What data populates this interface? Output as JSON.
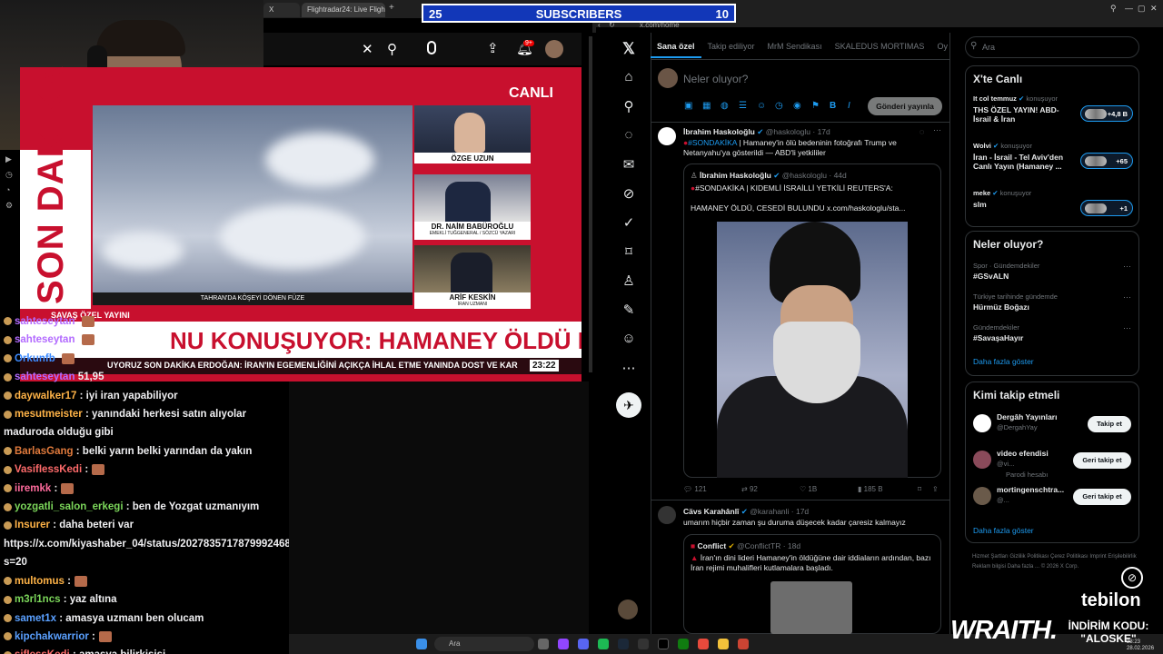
{
  "browser": {
    "tab1_label": "X",
    "tab2_label": "Flightradar24: Live Flight T",
    "new_tab": "+",
    "url": "x.com/home",
    "window_controls": [
      "⚲",
      "—",
      "▢",
      "✕"
    ]
  },
  "subscribers": {
    "left": "25",
    "label": "SUBSCRIBERS",
    "right": "10"
  },
  "youtube": {
    "notif_count": "9+"
  },
  "tv": {
    "son_dakika": "SON DAKİKA",
    "canli": "CANLI",
    "video_caption": "TAHRAN'DA KÖŞEYİ DÖNEN FÜZE",
    "panel1_name": "ÖZGE UZUN",
    "panel2_name": "DR. NAİM BABÜROĞLU",
    "panel2_sub": "EMEKLİ TUĞGENERAL / SÖZCÜ YAZARI",
    "panel3_name": "ARİF KESKİN",
    "panel3_sub": "İRAN UZMANI",
    "special": "SAVAŞ ÖZEL YAYINI",
    "headline": "NU KONUŞUYOR: HAMANEY ÖLDÜ MÜ?",
    "ticker": "UYORUZ  SON DAKİKA  ERDOĞAN: İRAN'IN EGEMENLİĞİNİ AÇIKÇA İHLAL ETME YANINDA DOST VE KAR",
    "clock": "23:22"
  },
  "chat": {
    "messages": [
      {
        "user": "sahteseytan",
        "text": "",
        "color": "#b36bff"
      },
      {
        "user": "sahteseytan",
        "text": "",
        "color": "#b36bff"
      },
      {
        "user": "Orkunfb",
        "text": "",
        "color": "#3d8bff"
      },
      {
        "user": "sahteseytan",
        "text": "51,95",
        "color": "#b36bff"
      },
      {
        "user": "daywalker17",
        "text": ": iyi iran yapabiliyor",
        "color": "#ffb347"
      },
      {
        "user": "mesutmeister",
        "text": ": yanındaki herkesi satın alıyolar maduroda olduğu gibi",
        "color": "#ffb347"
      },
      {
        "user": "BarlasGang",
        "text": ": belki yarın belki yarından da yakın",
        "color": "#e07a3c"
      },
      {
        "user": "VasifIessKedi",
        "text": ":",
        "color": "#ff6b6b"
      },
      {
        "user": "iiremkk",
        "text": ":",
        "color": "#ff6b9d"
      },
      {
        "user": "yozgatli_salon_erkegi",
        "text": ": ben de Yozgat uzmanıyım",
        "color": "#7bd65a"
      },
      {
        "user": "Insurer",
        "text": ": daha beteri var https://x.com/kiyashaber_04/status/2027835717879992468?s=20",
        "color": "#ffb347"
      },
      {
        "user": "multomus",
        "text": ":",
        "color": "#ffb347"
      },
      {
        "user": "m3rl1ncs",
        "text": ": yaz altına",
        "color": "#7bd65a"
      },
      {
        "user": "samet1x",
        "text": ": amasya uzmanı ben olucam",
        "color": "#5aa0ff"
      },
      {
        "user": "kipchakwarrior",
        "text": ":",
        "color": "#5aa0ff"
      },
      {
        "user": "sifIessKedi",
        "text": ": amasya bilirkişisi",
        "color": "#ff6b6b"
      }
    ]
  },
  "x": {
    "tabs": [
      "Sana özel",
      "Takip ediliyor",
      "MrM Sendikası",
      "SKALEDUS MORTIMAS",
      "Oy"
    ],
    "compose_placeholder": "Neler oluyor?",
    "post_button": "Gönderi yayınla",
    "tweet1": {
      "name": "İbrahim Haskoloğlu",
      "handle": "@haskologlu · 17d",
      "text_tag": "#SONDAKİKA",
      "text": " | Hamaney'in ölü bedeninin fotoğrafı Trump ve Netanyahu'ya gösterildi — ABD'li yetkililer",
      "quote_name": "İbrahim Haskoloğlu",
      "quote_handle": "@haskologlu · 44d",
      "quote_line1": "#SONDAKİKA | KIDEMLİ İSRAİLLİ YETKİLİ REUTERS'A:",
      "quote_line2": "HAMANEY ÖLDÜ, CESEDİ BULUNDU  x.com/haskologlu/sta...",
      "replies": "121",
      "reposts": "92",
      "likes": "1B",
      "views": "185 B"
    },
    "tweet2": {
      "name": "Cävs Karahânlî",
      "handle": "@karahanli · 17d",
      "text": "umarım hiçbir zaman şu duruma düşecek kadar çaresiz kalmayız",
      "quote_name": "Conflict",
      "quote_handle": "@ConflictTR · 18d",
      "quote_text": "İran'ın dini lideri Hamaney'in öldüğüne dair iddiaların ardından, bazı İran rejimi muhalifleri kutlamalara başladı."
    },
    "search_placeholder": "Ara",
    "live": {
      "title": "X'te Canlı",
      "items": [
        {
          "host": "It col temmuz",
          "status": "konuşuyor",
          "title": "THS ÖZEL YAYIN! ABD-İsrail & İran",
          "count": "+4,8 B"
        },
        {
          "host": "Wolvi",
          "status": "konuşuyor",
          "title": "İran - İsrail - Tel Aviv'den Canlı Yayın (Hamaney ...",
          "count": "+65"
        },
        {
          "host": "meke",
          "status": "konuşuyor",
          "title": "slm",
          "count": "+1"
        }
      ]
    },
    "trends": {
      "title": "Neler oluyor?",
      "items": [
        {
          "context": "Spor · Gündemdekiler",
          "name": "#GSvALN"
        },
        {
          "context": "Türkiye tarihinde gündemde",
          "name": "Hürmüz Boğazı"
        },
        {
          "context": "Gündemdekiler",
          "name": "#SavaşaHayır"
        }
      ],
      "more": "Daha fazla göster"
    },
    "who_to_follow": {
      "title": "Kimi takip etmeli",
      "items": [
        {
          "name": "Dergâh Yayınları",
          "handle": "@DergahYay",
          "note": "",
          "button": "Takip et"
        },
        {
          "name": "video efendisi",
          "handle": "@vi...",
          "note": "Parodi hesabı",
          "button": "Geri takip et"
        },
        {
          "name": "mortingenschtra...",
          "handle": "@...",
          "note": "",
          "button": "Geri takip et"
        }
      ],
      "more": "Daha fazla göster"
    },
    "footer": "Hizmet Şartları  Gizlilik Politikası  Çerez Politikası  Imprint  Erişilebilirlik  Reklam bilgisi  Daha fazla ... © 2026 X Corp."
  },
  "overlay": {
    "wraith": "WRAITH.",
    "indirim_label": "İNDİRİM KODU:",
    "indirim_code": "\"ALOSKE\"",
    "tebilon": "tebilon",
    "clock_time": "23:23",
    "clock_date": "28.02.2026",
    "taskbar_search": "Ara"
  }
}
